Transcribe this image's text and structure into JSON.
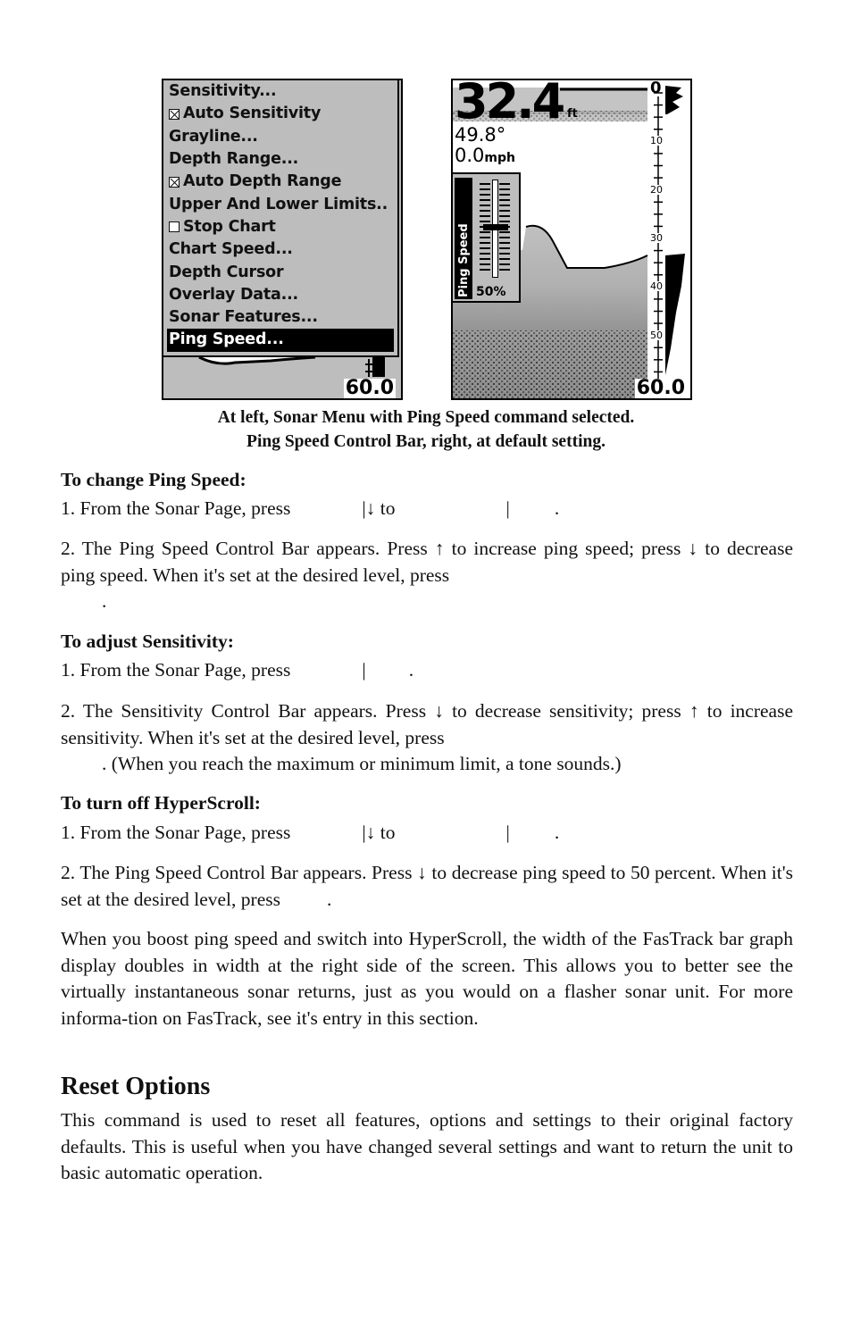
{
  "menu_screenshot": {
    "items": [
      {
        "label": "Sensitivity...",
        "checkbox": null,
        "selected": false
      },
      {
        "label": "Auto Sensitivity",
        "checkbox": "checked",
        "selected": false
      },
      {
        "label": "Grayline...",
        "checkbox": null,
        "selected": false
      },
      {
        "label": "Depth Range...",
        "checkbox": null,
        "selected": false
      },
      {
        "label": "Auto Depth Range",
        "checkbox": "checked",
        "selected": false
      },
      {
        "label": "Upper And Lower Limits..",
        "checkbox": null,
        "selected": false
      },
      {
        "label": "Stop Chart",
        "checkbox": "unchecked",
        "selected": false
      },
      {
        "label": "Chart Speed...",
        "checkbox": null,
        "selected": false
      },
      {
        "label": "Depth Cursor",
        "checkbox": null,
        "selected": false
      },
      {
        "label": "Overlay Data...",
        "checkbox": null,
        "selected": false
      },
      {
        "label": "Sonar Features...",
        "checkbox": null,
        "selected": false
      },
      {
        "label": "Ping Speed...",
        "checkbox": null,
        "selected": true
      }
    ],
    "depth_range_readout": "60.0"
  },
  "sonar_screenshot": {
    "depth": "32.4",
    "depth_unit": "ft",
    "temperature": "49.8°",
    "speed": "0.0",
    "speed_unit": "mph",
    "scale_top": "0",
    "scale_labels": [
      "10",
      "20",
      "30",
      "40",
      "50"
    ],
    "depth_range_readout": "60.0",
    "ping_speed_label": "Ping Speed",
    "ping_speed_value": "50%",
    "ping_speed_fraction": 0.5
  },
  "caption": {
    "line1": "At left, Sonar Menu with Ping Speed command selected.",
    "line2": "Ping Speed Control Bar, right, at default setting."
  },
  "sections": {
    "change_ping": {
      "heading": "To change Ping Speed:",
      "step1": "1. From the Sonar Page, press",
      "step1_mid": "|↓ to",
      "step1_bar": "|",
      "step1_end": ".",
      "step2": "2. The Ping Speed Control Bar appears. Press ↑ to increase ping speed; press ↓ to decrease ping speed. When it's set at the desired level, press",
      "step2_end": "."
    },
    "adjust_sensitivity": {
      "heading": "To adjust Sensitivity:",
      "step1": "1. From the Sonar Page, press",
      "step1_bar": "|",
      "step1_end": ".",
      "step2": "2. The Sensitivity Control Bar appears. Press ↓ to decrease sensitivity; press ↑ to increase sensitivity. When it's set at the desired level, press",
      "step2_end": ". (When you reach the maximum or minimum limit, a tone sounds.)"
    },
    "hyperscroll": {
      "heading": "To turn off HyperScroll:",
      "step1": "1. From the Sonar Page, press",
      "step1_mid": "|↓ to",
      "step1_bar": "|",
      "step1_end": ".",
      "step2": "2. The Ping Speed Control Bar appears. Press ↓ to decrease ping speed to 50 percent. When it's set at the desired level, press",
      "step2_end": ".",
      "note": "When you boost ping speed and switch into HyperScroll, the width of the FasTrack bar graph display doubles in width at the right side of the screen. This allows you to better see the virtually instantaneous sonar returns, just as you would on a flasher sonar unit. For more informa-tion on FasTrack, see it's entry in this section."
    },
    "reset_options": {
      "title": "Reset Options",
      "body": "This command is used to reset all features, options and settings to their original factory defaults. This is useful when you have changed several settings and want to return the unit to basic automatic operation."
    }
  }
}
